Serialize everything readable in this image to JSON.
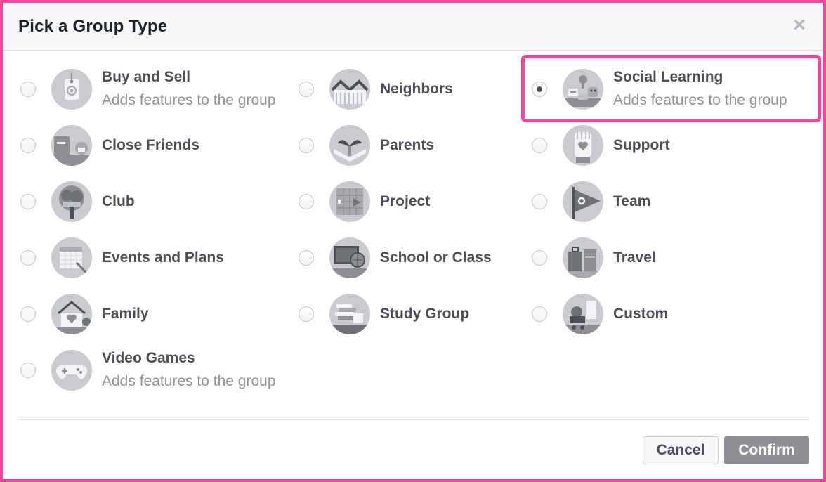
{
  "dialog": {
    "title": "Pick a Group Type",
    "close_symbol": "×",
    "highlight_color": "#e94a9a",
    "confirm_color": "#8d8f93"
  },
  "options": [
    {
      "label": "Buy and Sell",
      "description": "Adds features to the group",
      "icon": "tag-icon",
      "selected": false
    },
    {
      "label": "Neighbors",
      "icon": "houses-icon",
      "selected": false
    },
    {
      "label": "Social Learning",
      "description": "Adds features to the group",
      "icon": "lightbulb-classroom-icon",
      "selected": true
    },
    {
      "label": "Close Friends",
      "icon": "friends-icon",
      "selected": false
    },
    {
      "label": "Parents",
      "icon": "hands-plant-icon",
      "selected": false
    },
    {
      "label": "Support",
      "icon": "hand-heart-icon",
      "selected": false
    },
    {
      "label": "Club",
      "icon": "tree-icon",
      "selected": false
    },
    {
      "label": "Project",
      "icon": "grid-board-icon",
      "selected": false
    },
    {
      "label": "Team",
      "icon": "pennant-flag-icon",
      "selected": false
    },
    {
      "label": "Events and Plans",
      "icon": "calendar-icon",
      "selected": false
    },
    {
      "label": "School or Class",
      "icon": "chalkboard-globe-icon",
      "selected": false
    },
    {
      "label": "Travel",
      "icon": "suitcase-icon",
      "selected": false
    },
    {
      "label": "Family",
      "icon": "house-heart-icon",
      "selected": false
    },
    {
      "label": "Study Group",
      "icon": "books-icon",
      "selected": false
    },
    {
      "label": "Custom",
      "icon": "custom-scene-icon",
      "selected": false
    },
    {
      "label": "Video Games",
      "description": "Adds features to the group",
      "icon": "gamepad-icon",
      "selected": false
    }
  ],
  "footer": {
    "cancel_label": "Cancel",
    "confirm_label": "Confirm"
  }
}
